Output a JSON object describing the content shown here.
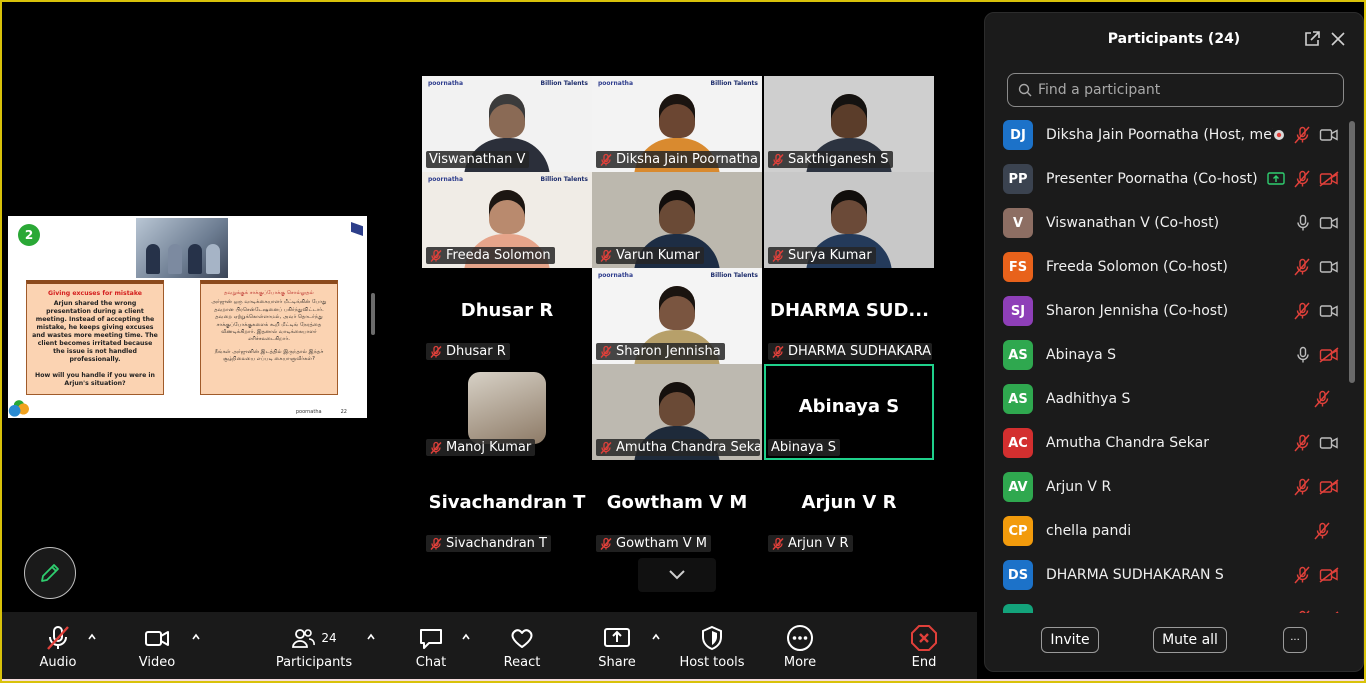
{
  "slide": {
    "number": "2",
    "brand": "poornatha",
    "page": "22",
    "english_title": "Giving excuses for mistake",
    "english_body": "Arjun shared the wrong presentation during a client meeting. Instead of accepting the mistake, he keeps giving excuses and wastes more meeting time. The client becomes irritated because the issue is not handled professionally.",
    "english_question": "How will you handle if you were in Arjun's situation?",
    "tamil_title": "தவறுக்குக் சாக்குப்போக்கு சொல்லுதல்",
    "tamil_body": "அர்ஜுன் ஒரு வாடிக்கையாளர் மீட்டிங்கின் போது தவறான பிரசென்டேஷனைப் பகிர்ந்துவிட்டார். தவறை ஏற்றுக்கொள்ளாமல், அவர் தொடர்ந்து சாக்குப்போக்குகளைக் கூறி மீட்டிங் நேரத்தை வீணடிக்கிறார். இதனால் வாடிக்கையாளர் எரிச்சலடைகிறார்.",
    "tamil_question": "நீங்கள் அர்ஜுனின் இடத்தில் இருந்தால் இந்தச் சூழ்நிலையை எப்படி கையாளுவீர்கள்?"
  },
  "gallery": {
    "brand_left": "poornatha",
    "brand_right": "Billion Talents",
    "tiles": [
      {
        "name": "Viswanathan V",
        "muted": false,
        "video": true,
        "big": ""
      },
      {
        "name": "Diksha Jain Poornatha",
        "muted": true,
        "video": true,
        "big": ""
      },
      {
        "name": "Sakthiganesh S",
        "muted": true,
        "video": true,
        "big": ""
      },
      {
        "name": "Freeda Solomon",
        "muted": true,
        "video": true,
        "big": ""
      },
      {
        "name": "Varun Kumar",
        "muted": true,
        "video": true,
        "big": ""
      },
      {
        "name": "Surya Kumar",
        "muted": true,
        "video": true,
        "big": ""
      },
      {
        "name": "Dhusar R",
        "muted": true,
        "video": false,
        "big": "Dhusar R"
      },
      {
        "name": "Sharon Jennisha",
        "muted": true,
        "video": true,
        "big": ""
      },
      {
        "name": "DHARMA SUDHAKARA...",
        "muted": true,
        "video": false,
        "big": "DHARMA  SUD..."
      },
      {
        "name": "Manoj Kumar",
        "muted": true,
        "video": false,
        "big": ""
      },
      {
        "name": "Amutha Chandra Sekar",
        "muted": true,
        "video": true,
        "big": ""
      },
      {
        "name": "Abinaya S",
        "muted": false,
        "video": false,
        "big": "Abinaya S"
      },
      {
        "name": "Sivachandran T",
        "muted": true,
        "video": false,
        "big": "Sivachandran T"
      },
      {
        "name": "Gowtham V M",
        "muted": true,
        "video": false,
        "big": "Gowtham V M"
      },
      {
        "name": "Arjun V R",
        "muted": true,
        "video": false,
        "big": "Arjun V R"
      }
    ]
  },
  "toolbar": {
    "audio": "Audio",
    "video": "Video",
    "participants": "Participants",
    "participants_count": "24",
    "chat": "Chat",
    "react": "React",
    "share": "Share",
    "host_tools": "Host tools",
    "more": "More",
    "end": "End"
  },
  "panel": {
    "title": "Participants (24)",
    "search_placeholder": "Find a participant",
    "invite": "Invite",
    "mute_all": "Mute all",
    "more_label": "···",
    "participants": [
      {
        "initials": "DJ",
        "name": "Diksha Jain Poornatha (Host, me)",
        "color": "#1c72c9",
        "mic": "muted",
        "cam": "on",
        "extra": "record"
      },
      {
        "initials": "PP",
        "name": "Presenter Poornatha (Co-host)",
        "color": "#3b4350",
        "mic": "muted",
        "cam": "off",
        "extra": "share"
      },
      {
        "initials": "V",
        "name": "Viswanathan V (Co-host)",
        "color": "#8d6e63",
        "mic": "on",
        "cam": "on",
        "extra": ""
      },
      {
        "initials": "FS",
        "name": "Freeda Solomon (Co-host)",
        "color": "#e8621b",
        "mic": "muted",
        "cam": "on",
        "extra": ""
      },
      {
        "initials": "SJ",
        "name": "Sharon Jennisha (Co-host)",
        "color": "#8e3fb8",
        "mic": "muted",
        "cam": "on",
        "extra": ""
      },
      {
        "initials": "AS",
        "name": "Abinaya S",
        "color": "#2fa84f",
        "mic": "on",
        "cam": "off",
        "extra": ""
      },
      {
        "initials": "AS",
        "name": "Aadhithya S",
        "color": "#2fa84f",
        "mic": "muted",
        "cam": "none",
        "extra": ""
      },
      {
        "initials": "AC",
        "name": "Amutha Chandra Sekar",
        "color": "#d32f2f",
        "mic": "muted",
        "cam": "on",
        "extra": ""
      },
      {
        "initials": "AV",
        "name": "Arjun V R",
        "color": "#2fa84f",
        "mic": "muted",
        "cam": "off",
        "extra": ""
      },
      {
        "initials": "CP",
        "name": "chella pandi",
        "color": "#f29b0c",
        "mic": "muted",
        "cam": "none",
        "extra": ""
      },
      {
        "initials": "DS",
        "name": "DHARMA SUDHAKARAN S",
        "color": "#1c72c9",
        "mic": "muted",
        "cam": "off",
        "extra": ""
      },
      {
        "initials": "",
        "name": "",
        "color": "#13a37b",
        "mic": "muted",
        "cam": "off",
        "extra": ""
      }
    ]
  },
  "colors": {
    "muted_red": "#e0403a",
    "accent_green": "#1fd08b",
    "end_red": "#e0403a",
    "frame_yellow": "#d8c20a"
  },
  "icons": [
    "microphone-muted-icon",
    "video-camera-icon",
    "participants-icon",
    "chat-icon",
    "react-heart-icon",
    "share-screen-icon",
    "shield-icon",
    "more-icon",
    "end-icon",
    "search-icon",
    "pop-out-icon",
    "close-icon",
    "pencil-icon",
    "chevron-down-icon",
    "chevron-up-icon"
  ]
}
